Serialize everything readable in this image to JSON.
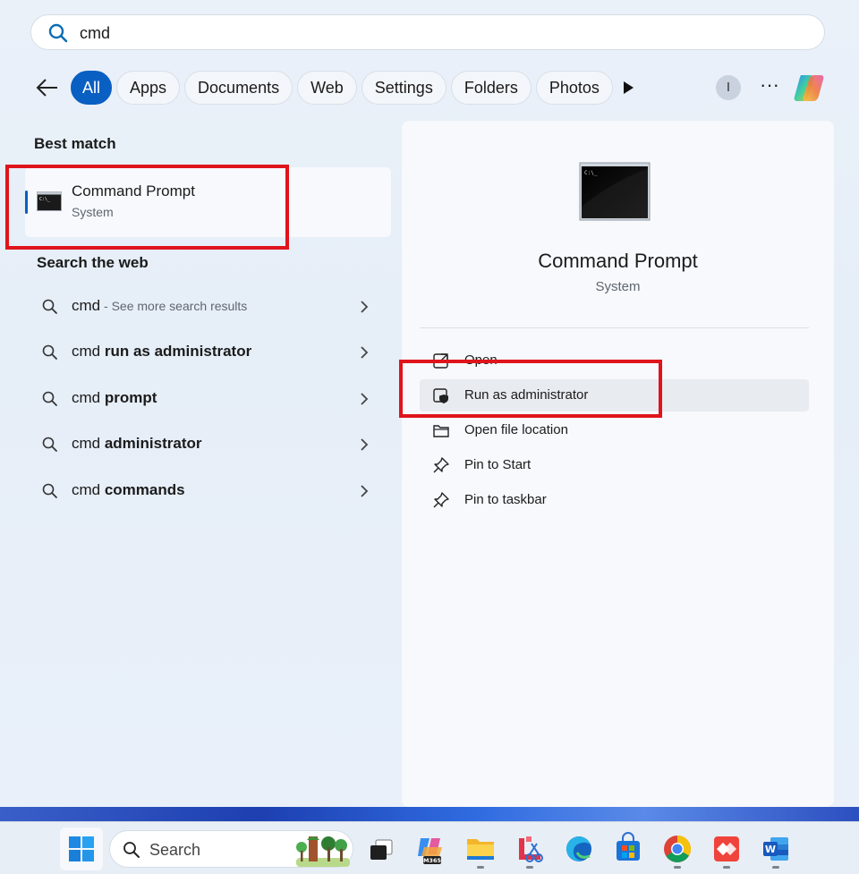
{
  "search": {
    "query": "cmd"
  },
  "filters": [
    "All",
    "Apps",
    "Documents",
    "Web",
    "Settings",
    "Folders",
    "Photos"
  ],
  "account_initial": "I",
  "more_label": "···",
  "best_match": {
    "heading": "Best match",
    "name": "Command Prompt",
    "type": "System"
  },
  "web": {
    "heading": "Search the web",
    "rows": [
      {
        "prefix": "cmd",
        "bold": "",
        "hint": " - See more search results"
      },
      {
        "prefix": "cmd ",
        "bold": "run as administrator",
        "hint": ""
      },
      {
        "prefix": "cmd ",
        "bold": "prompt",
        "hint": ""
      },
      {
        "prefix": "cmd ",
        "bold": "administrator",
        "hint": ""
      },
      {
        "prefix": "cmd ",
        "bold": "commands",
        "hint": ""
      }
    ]
  },
  "detail": {
    "title": "Command Prompt",
    "subtitle": "System",
    "actions": [
      "Open",
      "Run as administrator",
      "Open file location",
      "Pin to Start",
      "Pin to taskbar"
    ]
  },
  "taskbar": {
    "search_label": "Search",
    "m365_label": "M365"
  },
  "colors": {
    "accent": "#0a5fc2",
    "highlight": "#e0141b"
  }
}
